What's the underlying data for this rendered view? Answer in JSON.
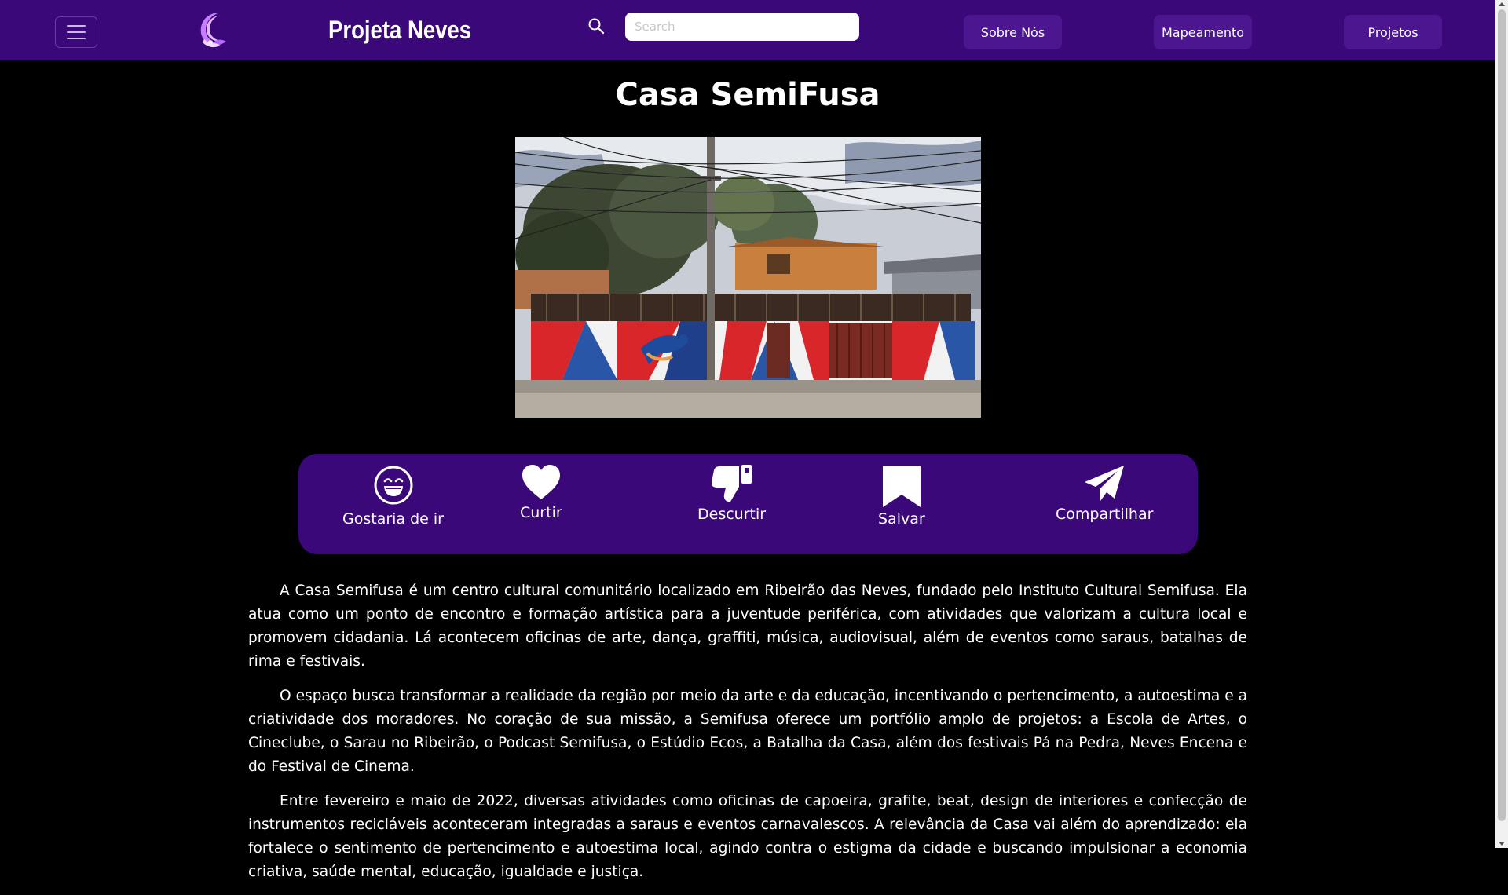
{
  "header": {
    "menu_icon": "hamburger-menu-icon",
    "logo_icon": "crescent-hands-logo-icon",
    "brand": "Projeta Neves",
    "search_icon": "search-icon",
    "search_placeholder": "Search",
    "search_value": "",
    "nav": [
      {
        "label": "Sobre Nós"
      },
      {
        "label": "Mapeamento"
      },
      {
        "label": "Projetos"
      }
    ]
  },
  "main": {
    "title": "Casa SemiFusa",
    "actions": [
      {
        "label": "Gostaria de ir",
        "icon": "laughing-face-icon"
      },
      {
        "label": "Curtir",
        "icon": "heart-icon"
      },
      {
        "label": "Descurtir",
        "icon": "thumbs-down-icon"
      },
      {
        "label": "Salvar",
        "icon": "bookmark-icon"
      },
      {
        "label": "Compartilhar",
        "icon": "paper-plane-icon"
      }
    ],
    "paragraphs": [
      "A Casa Semifusa é um centro cultural comunitário localizado em Ribeirão das Neves, fundado pelo Instituto Cultural Semifusa. Ela atua como um ponto de encontro e formação artística para a juventude periférica, com atividades que valorizam a cultura local e promovem cidadania. Lá acontecem oficinas de arte, dança, graffiti, música, audiovisual, além de eventos como saraus, batalhas de rima e festivais.",
      "O espaço busca transformar a realidade da região por meio da arte e da educação, incentivando o pertencimento, a autoestima e a criatividade dos moradores. No coração de sua missão, a Semifusa oferece um portfólio amplo de projetos: a Escola de Artes, o Cineclube, o Sarau no Ribeirão, o Podcast Semifusa, o Estúdio Ecos, a Batalha da Casa, além dos festivais Pá na Pedra, Neves Encena e do Festival de Cinema.",
      "Entre fevereiro e maio de 2022, diversas atividades como oficinas de capoeira, grafite, beat, design de interiores e confecção de instrumentos recicláveis aconteceram integradas a saraus e eventos carnavalescos. A relevância da Casa vai além do aprendizado: ela fortalece o sentimento de pertencimento e autoestima local, agindo contra o estigma da cidade e buscando impulsionar a economia criativa, saúde mental, educação, igualdade e justiça."
    ]
  },
  "colors": {
    "header_bg": "#3a0878",
    "nav_button_bg": "#4b1690",
    "action_panel_bg": "#3a0878",
    "page_bg": "#000000",
    "text": "#ffffff",
    "logo_accent": "#c77dff"
  }
}
